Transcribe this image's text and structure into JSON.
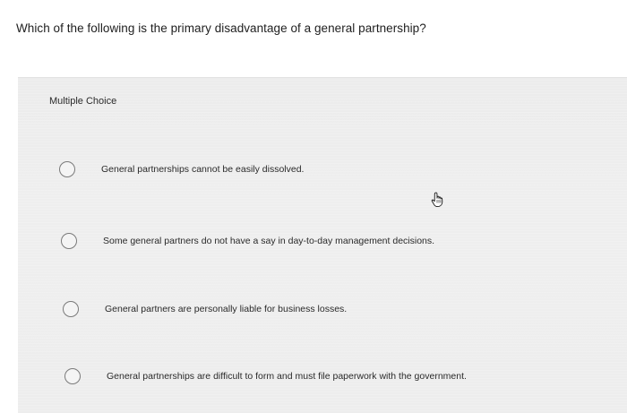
{
  "question": {
    "text": "Which of the following is the primary disadvantage of a general partnership?"
  },
  "choices_section": {
    "label": "Multiple Choice",
    "options": [
      {
        "label": "General partnerships cannot be easily dissolved."
      },
      {
        "label": "Some general partners do not have a say in day-to-day management decisions."
      },
      {
        "label": "General partners are personally liable for business losses."
      },
      {
        "label": "General partnerships are difficult to form and must file paperwork with the government."
      }
    ]
  },
  "cursor": {
    "icon": "hand-pointer-icon"
  },
  "colors": {
    "panel_background": "#ececec",
    "radio_border": "#7a7a7a",
    "text": "#222222"
  }
}
